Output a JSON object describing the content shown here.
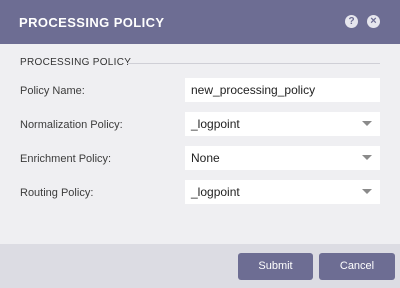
{
  "dialog": {
    "title": "PROCESSING POLICY",
    "help_icon": "?",
    "close_icon": "×"
  },
  "section": {
    "title": "PROCESSING POLICY"
  },
  "fields": {
    "policy_name": {
      "label": "Policy Name:",
      "value": "new_processing_policy"
    },
    "normalization": {
      "label": "Normalization Policy:",
      "value": "_logpoint"
    },
    "enrichment": {
      "label": "Enrichment Policy:",
      "value": "None"
    },
    "routing": {
      "label": "Routing Policy:",
      "value": "_logpoint"
    }
  },
  "buttons": {
    "submit": "Submit",
    "cancel": "Cancel"
  },
  "colors": {
    "header": "#6d6d93",
    "button": "#6d6d93",
    "body": "#efeff2",
    "footer": "#dcdce3"
  }
}
